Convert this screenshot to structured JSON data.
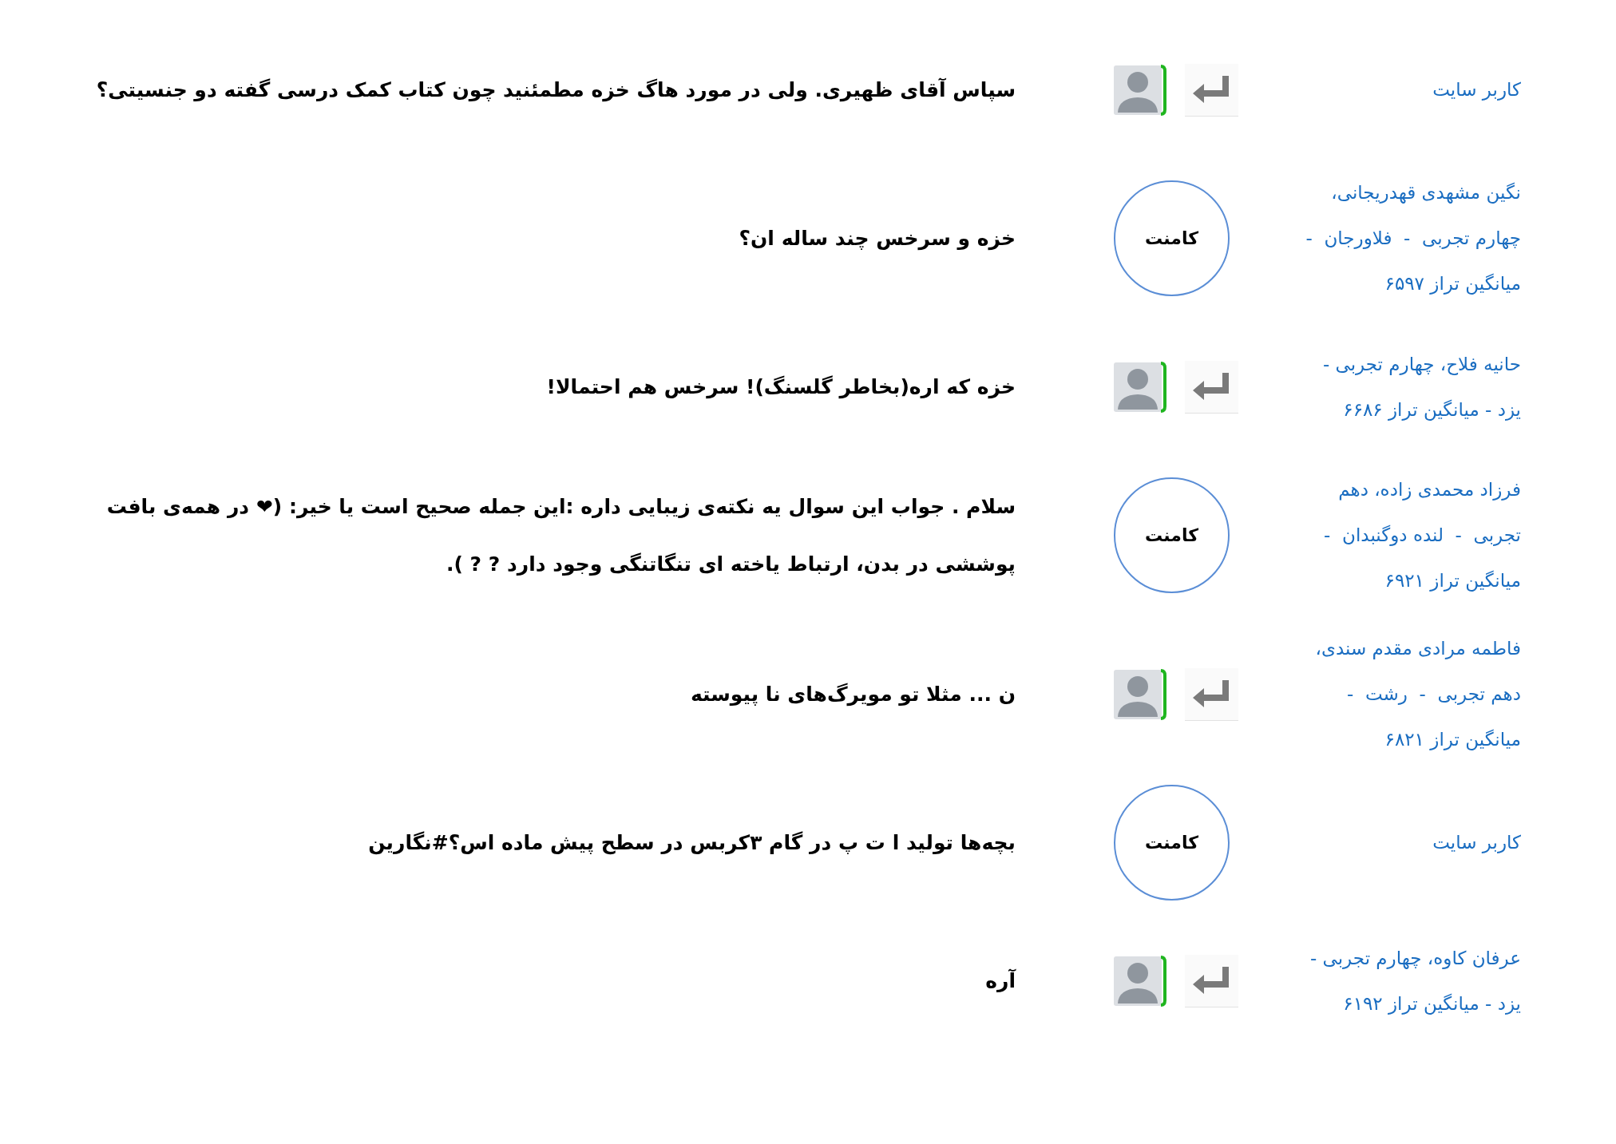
{
  "comments": [
    {
      "author_lines": [
        "کاربر سایت"
      ],
      "kind": "reply",
      "text_lines": [
        "سپاس آقای ظهیری. ولی در مورد هاگ خزه مطمئنید چون کتاب کمک درسی گفته دو جنسیتی؟"
      ]
    },
    {
      "author_lines": [
        "نگین مشهدی قهدریجانی،",
        "چهارم تجربی  -  فلاورجان  -",
        "میانگین تراز ۶۵۹۷"
      ],
      "kind": "comment",
      "button": "کامنت",
      "text_lines": [
        "خزه و سرخس چند ساله ان؟"
      ]
    },
    {
      "author_lines": [
        "حانیه فلاح، چهارم تجربی -",
        "یزد - میانگین تراز ۶۶۸۶"
      ],
      "kind": "reply",
      "text_lines": [
        "خزه که اره(بخاطر گلسنگ)! سرخس هم احتمالا!"
      ]
    },
    {
      "author_lines": [
        "فرزاد محمدی زاده، دهم",
        "تجربی  -  لنده دوگنبدان  -",
        "میانگین تراز ۶۹۲۱"
      ],
      "kind": "comment",
      "button": "کامنت",
      "text_lines": [
        "سلام . جواب این سوال یه نکته‌ی زیبایی داره :این جمله صحیح است یا خیر: (❤ در همه‌ی بافت",
        "پوششی در بدن، ارتباط یاخته ای تنگاتنگی وجود دارد ? ? )."
      ]
    },
    {
      "author_lines": [
        "فاطمه مرادی مقدم سندی،",
        "دهم تجربی  -  رشت  -",
        "میانگین تراز ۶۸۲۱"
      ],
      "kind": "reply",
      "text_lines": [
        "ن ... مثلا تو مویرگ‌های نا پیوسته"
      ]
    },
    {
      "author_lines": [
        "کاربر سایت"
      ],
      "kind": "comment",
      "button": "کامنت",
      "text_lines": [
        "بچه‌ها تولید ا ت پ در گام ۳کربس در سطح پیش ماده اس؟#نگارین"
      ]
    },
    {
      "author_lines": [
        "عرفان کاوه، چهارم تجربی -",
        "یزد - میانگین تراز ۶۱۹۲"
      ],
      "kind": "reply",
      "text_lines": [
        "آره"
      ]
    }
  ]
}
